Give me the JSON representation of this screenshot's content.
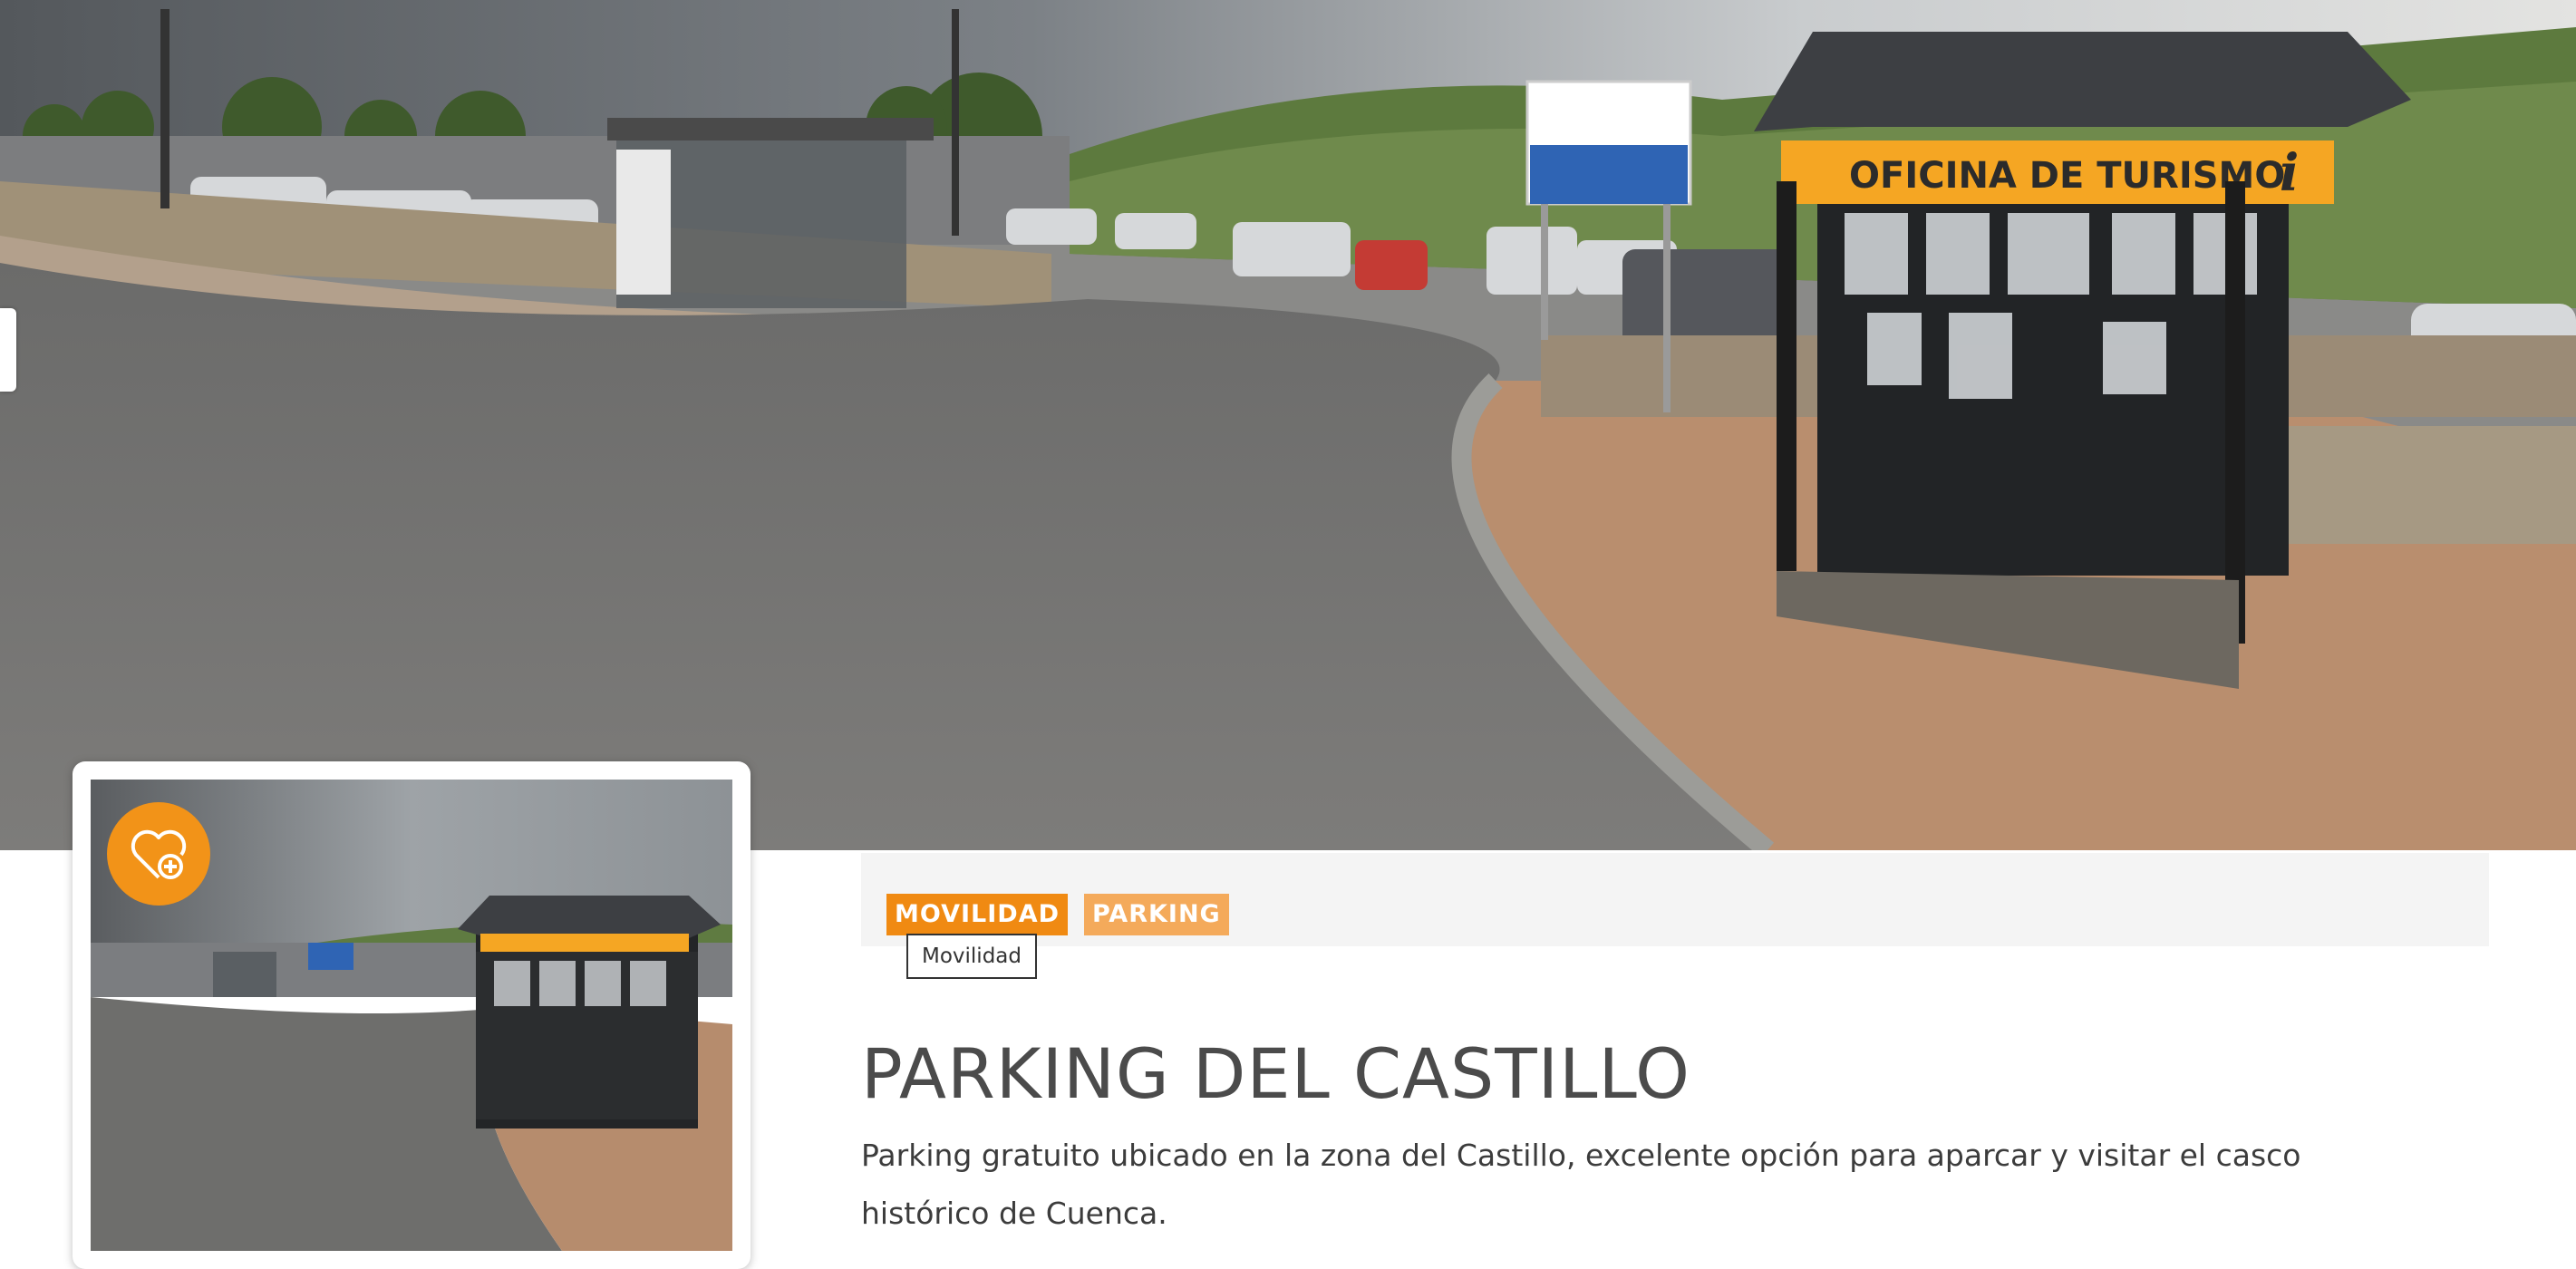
{
  "hero": {
    "image_alt": "Street view of the Parking del Castillo with tourist office kiosk"
  },
  "hero_signs": {
    "kiosk_sign": "OFICINA DE TURISMO",
    "kiosk_info": "i"
  },
  "thumbnail": {
    "favorite_icon": "heart-plus-icon"
  },
  "tags": [
    {
      "label": "MOVILIDAD",
      "color": "#f08a12"
    },
    {
      "label": "PARKING",
      "color": "#f4aa5b"
    }
  ],
  "tooltip": "Movilidad",
  "title": "PARKING DEL CASTILLO",
  "description": "Parking gratuito ubicado en la zona del Castillo, excelente opción para aparcar y visitar el casco histórico de Cuenca.",
  "colors": {
    "accent": "#f29318",
    "text": "#4b4b4b"
  }
}
